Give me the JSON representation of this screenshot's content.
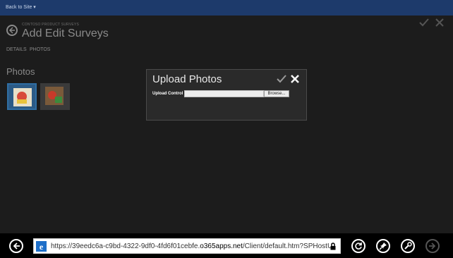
{
  "top_bar": {
    "back_link": "Back to Site  ▾"
  },
  "app": {
    "subtitle": "CONTOSO PRODUCT SURVEYS",
    "title": "Add Edit Surveys",
    "tabs": [
      {
        "label": "DETAILS"
      },
      {
        "label": "PHOTOS"
      }
    ],
    "section_title": "Photos",
    "icons": {
      "back": "arrow-left-circle-icon",
      "save": "checkmark-icon",
      "close": "close-icon"
    }
  },
  "dialog": {
    "title": "Upload Photos",
    "field_label": "Upload Control",
    "file_value": "",
    "browse_label": "Browse...",
    "icons": {
      "confirm": "checkmark-icon",
      "close": "close-icon"
    }
  },
  "browser": {
    "url_prefix": "https://39eedc6a-c9bd-4322-9df0-4fd6f01cebfe.",
    "url_domain": "o365apps.net",
    "url_suffix": "/Client/default.htm?SPHostU",
    "icons": [
      "back-icon",
      "ie-logo-icon",
      "lock-icon",
      "refresh-icon",
      "pin-icon",
      "tools-icon",
      "forward-icon"
    ]
  },
  "colors": {
    "top_bar": "#1d3a6b",
    "app_background": "#1c1c1c",
    "dialog_background": "#2a2a2a",
    "selected_thumb": "#2c5b86"
  }
}
